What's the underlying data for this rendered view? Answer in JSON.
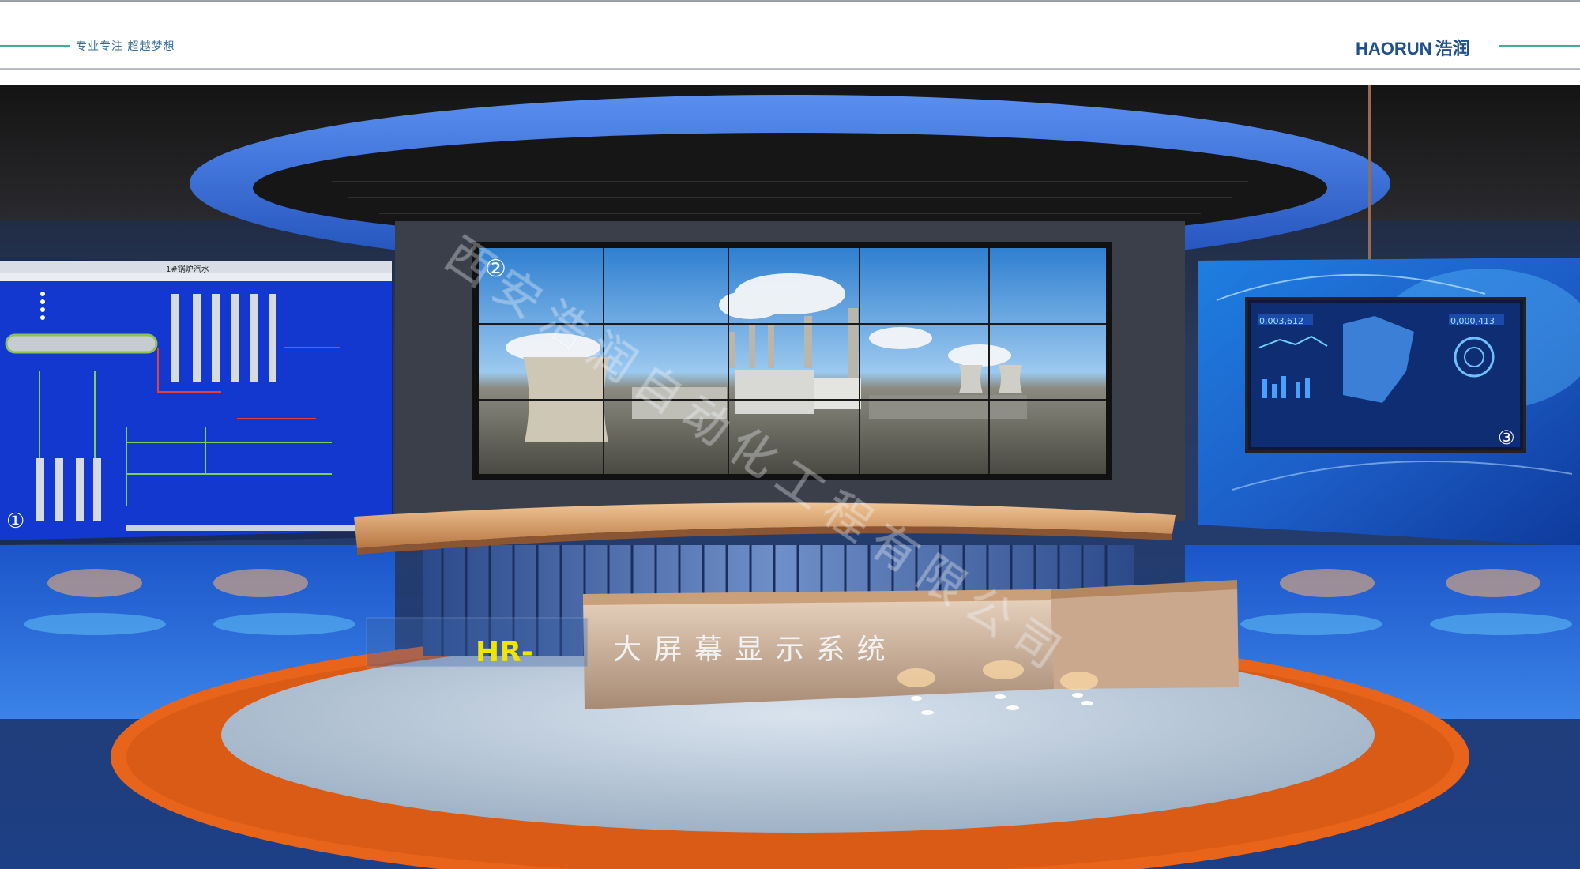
{
  "header": {
    "slogan": "专业专注 超越梦想",
    "logo_text": "HAORUN",
    "logo_cn": "浩润"
  },
  "screens": {
    "left_marker": "①",
    "center_marker": "②",
    "right_marker": "③",
    "left_panel_title": "1#锅炉汽水",
    "right_counter_left": "0,003,612",
    "right_counter_right": "0,000,413"
  },
  "desk": {
    "caption_prefix": "HR-",
    "caption": "大 屏 幕 显 示 系 统"
  },
  "watermark": "西安浩润自动化工程有限公司",
  "colors": {
    "caption_prefix": "#f2e600",
    "stage_orange": "#e8641a",
    "screen_blue": "#1238d0"
  }
}
